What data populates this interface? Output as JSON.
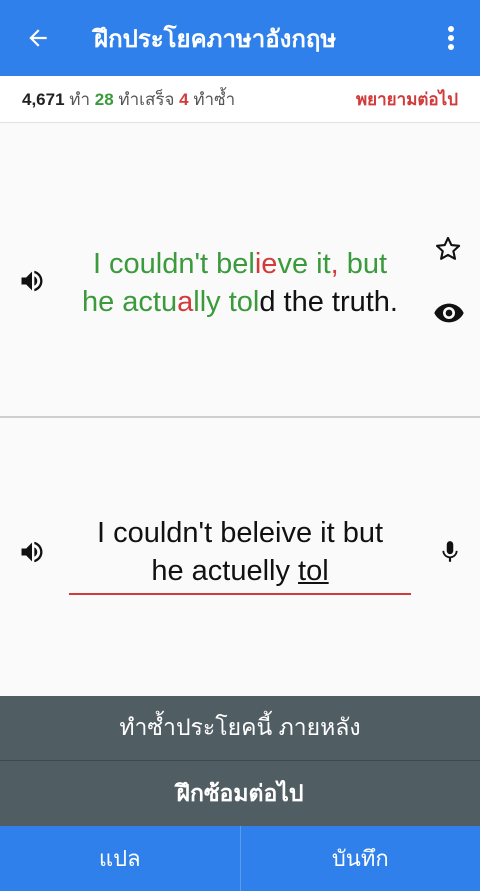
{
  "appbar": {
    "title": "ฝึกประโยคภาษาอังกฤษ"
  },
  "stats": {
    "total": "4,671",
    "total_label": " ทำ ",
    "done": "28",
    "done_label": " ทำเสร็จ ",
    "repeat": "4",
    "repeat_label": " ทำซ้ำ",
    "try_label": "พยายามต่อไป"
  },
  "target": {
    "line1": [
      {
        "t": "I couldn't bel",
        "c": "g"
      },
      {
        "t": "ie",
        "c": "r"
      },
      {
        "t": "ve it",
        "c": "g"
      },
      {
        "t": ",",
        "c": "r"
      },
      {
        "t": " but",
        "c": "g"
      }
    ],
    "line2": [
      {
        "t": "he actu",
        "c": "g"
      },
      {
        "t": "a",
        "c": "r"
      },
      {
        "t": "lly tol",
        "c": "g"
      },
      {
        "t": "d the truth.",
        "c": "b"
      }
    ]
  },
  "answer": {
    "line1": "I couldn't beleive it  but",
    "line2_prefix": "he actuelly ",
    "line2_current": "tol"
  },
  "actions": {
    "repeat_later": "ทำซ้ำประโยคนี้ ภายหลัง",
    "next": "ฝึกซ้อมต่อไป"
  },
  "bottom": {
    "translate": "แปล",
    "save": "บันทึก"
  },
  "colors": {
    "primary": "#2f80ea",
    "correct": "#3a9a3c",
    "wrong": "#d23b3b",
    "dark_bar": "#505d63"
  },
  "icons": [
    "back-arrow-icon",
    "more-vert-icon",
    "speaker-icon",
    "star-outline-icon",
    "eye-icon",
    "mic-icon"
  ]
}
